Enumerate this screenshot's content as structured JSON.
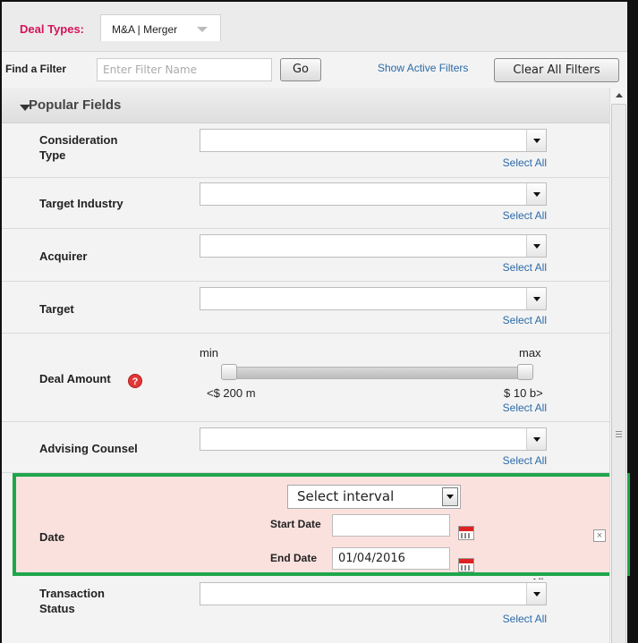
{
  "deal_types": {
    "label": "Deal Types:",
    "value": "M&A | Merger"
  },
  "filter": {
    "label": "Find a Filter",
    "placeholder": "Enter Filter Name",
    "go_label": "Go",
    "show_active_label": "Show Active Filters",
    "clear_all_label": "Clear All Filters"
  },
  "popular": {
    "title": "Popular Fields"
  },
  "select_all_label": "Select All",
  "fields": {
    "consideration_type": "Consideration Type",
    "target_industry": "Target Industry",
    "acquirer": "Acquirer",
    "target": "Target",
    "deal_amount": "Deal Amount",
    "advising_counsel": "Advising Counsel",
    "transaction_status": "Transaction Status"
  },
  "deal_amount": {
    "min_label": "min",
    "max_label": "max",
    "min_value": "<$ 200 m",
    "max_value": "$ 10 b>",
    "help": "?"
  },
  "date": {
    "label": "Date",
    "interval_value": "Select interval",
    "start_label": "Start Date",
    "start_value": "",
    "end_label": "End Date",
    "end_value": "01/04/2016",
    "all_label": "All"
  },
  "colors": {
    "deal_label": "#d4145a",
    "link": "#2b6aa8",
    "highlight_bg": "#fbe1de",
    "highlight_border": "#1ea64b"
  },
  "icons": [
    "dropdown-arrow-icon",
    "calendar-icon",
    "close-icon",
    "help-icon",
    "collapse-arrow-icon",
    "scroll-up-icon"
  ]
}
